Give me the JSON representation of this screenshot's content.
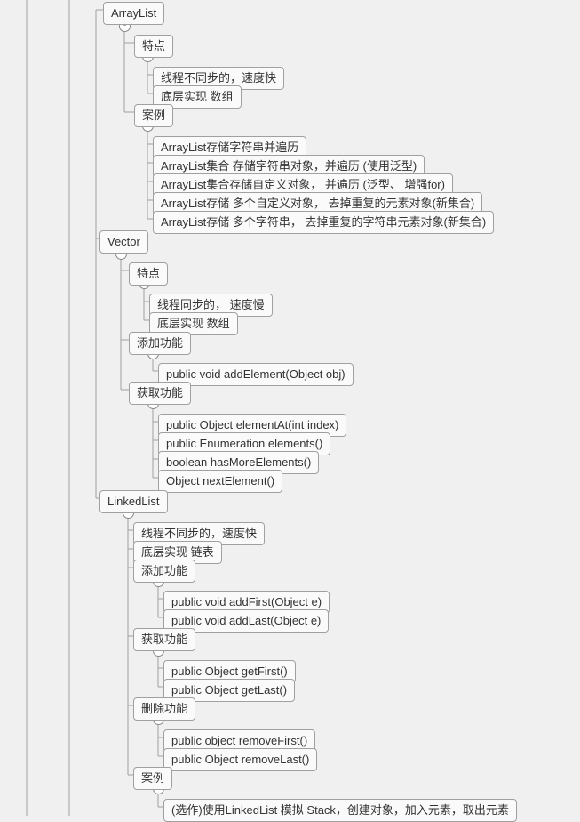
{
  "root_level": {
    "arraylist": {
      "label": "ArrayList",
      "children": {
        "features": {
          "label": "特点",
          "children": {
            "n1": {
              "label": "线程不同步的，速度快"
            },
            "n2": {
              "label": "底层实现 数组"
            }
          }
        },
        "cases": {
          "label": "案例",
          "children": {
            "c1": {
              "label": "ArrayList存储字符串并遍历"
            },
            "c2": {
              "label": "ArrayList集合 存储字符串对象，并遍历 (使用泛型)"
            },
            "c3": {
              "label": "ArrayList集合存储自定义对象， 并遍历 (泛型、 增强for)"
            },
            "c4": {
              "label": "ArrayList存储 多个自定义对象，  去掉重复的元素对象(新集合)"
            },
            "c5": {
              "label": "ArrayList存储 多个字符串，  去掉重复的字符串元素对象(新集合)"
            }
          }
        }
      }
    },
    "vector": {
      "label": "Vector",
      "children": {
        "features": {
          "label": "特点",
          "children": {
            "n1": {
              "label": "线程同步的， 速度慢"
            },
            "n2": {
              "label": "底层实现 数组"
            }
          }
        },
        "add": {
          "label": "添加功能",
          "children": {
            "a1": {
              "label": "public void addElement(Object obj)"
            }
          }
        },
        "get": {
          "label": "获取功能",
          "children": {
            "g1": {
              "label": "public Object elementAt(int index)"
            },
            "g2": {
              "label": "public Enumeration elements()"
            },
            "g3": {
              "label": "boolean hasMoreElements()"
            },
            "g4": {
              "label": "Object nextElement()"
            }
          }
        }
      }
    },
    "linkedlist": {
      "label": "LinkedList",
      "children": {
        "n1": {
          "label": "线程不同步的，速度快"
        },
        "n2": {
          "label": "底层实现 链表"
        },
        "add": {
          "label": "添加功能",
          "children": {
            "a1": {
              "label": "public void addFirst(Object e)"
            },
            "a2": {
              "label": "public void addLast(Object e)"
            }
          }
        },
        "get": {
          "label": "获取功能",
          "children": {
            "g1": {
              "label": "public Object getFirst()"
            },
            "g2": {
              "label": "public Object getLast()"
            }
          }
        },
        "remove": {
          "label": "删除功能",
          "children": {
            "r1": {
              "label": "public object removeFirst()"
            },
            "r2": {
              "label": "public Object removeLast()"
            }
          }
        },
        "cases": {
          "label": "案例",
          "children": {
            "c1": {
              "label": "(选作)使用LinkedList 模拟 Stack，创建对象，加入元素，取出元素"
            }
          }
        }
      }
    }
  },
  "toggle_symbol": "-"
}
